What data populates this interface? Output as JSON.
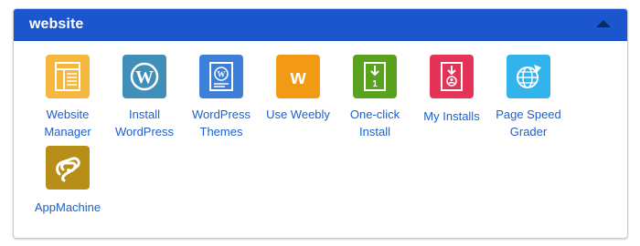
{
  "panel": {
    "title": "website",
    "collapse_icon": "caret-up-icon"
  },
  "apps": [
    {
      "label": "Website\nManager",
      "icon": "website-manager-icon",
      "color": "#f6b73c"
    },
    {
      "label": "Install\nWordPress",
      "icon": "wordpress-icon",
      "color": "#3f8fb8"
    },
    {
      "label": "WordPress\nThemes",
      "icon": "wordpress-themes-icon",
      "color": "#3d7ed9"
    },
    {
      "label": "Use Weebly",
      "icon": "weebly-icon",
      "color": "#f39a15"
    },
    {
      "label": "One-click\nInstall",
      "icon": "one-click-install-icon",
      "color": "#5aa11e"
    },
    {
      "label": "My Installs",
      "icon": "my-installs-icon",
      "color": "#e53358"
    },
    {
      "label": "Page Speed\nGrader",
      "icon": "page-speed-grader-icon",
      "color": "#33b3eb"
    },
    {
      "label": "AppMachine",
      "icon": "appmachine-icon",
      "color": "#b78e17"
    }
  ]
}
